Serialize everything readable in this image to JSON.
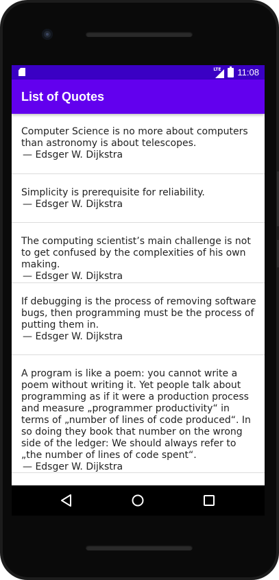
{
  "status_bar": {
    "network_label": "LTE",
    "time": "11:08"
  },
  "app_bar": {
    "title": "List of Quotes"
  },
  "quotes": [
    {
      "text": "Computer Science is no more about computers than astronomy is about telescopes.",
      "author": "— Edsger W. Dijkstra"
    },
    {
      "text": "Simplicity is prerequisite for reliability.",
      "author": "— Edsger W. Dijkstra"
    },
    {
      "text": "The computing scientist’s main challenge is not to get confused by the complexities of his own making.",
      "author": "— Edsger W. Dijkstra"
    },
    {
      "text": "If debugging is the process of removing software bugs, then programming must be the process of putting them in.",
      "author": "— Edsger W. Dijkstra"
    },
    {
      "text": "A program is like a poem: you cannot write a poem without writing it. Yet people talk about programming as if it were a production process and measure „programmer productivity“ in terms of „number of lines of code produced“. In so doing they book that number on the wrong side of the ledger: We should always refer to „the number of lines of code spent“.",
      "author": "— Edsger W. Dijkstra"
    }
  ],
  "nav_bar": {
    "back_icon": "back-triangle-icon",
    "home_icon": "home-circle-icon",
    "recents_icon": "recents-square-icon"
  },
  "colors": {
    "status_bar": "#3a00c4",
    "app_bar": "#6200ee",
    "divider": "#dcdcdc",
    "text": "#222222"
  }
}
